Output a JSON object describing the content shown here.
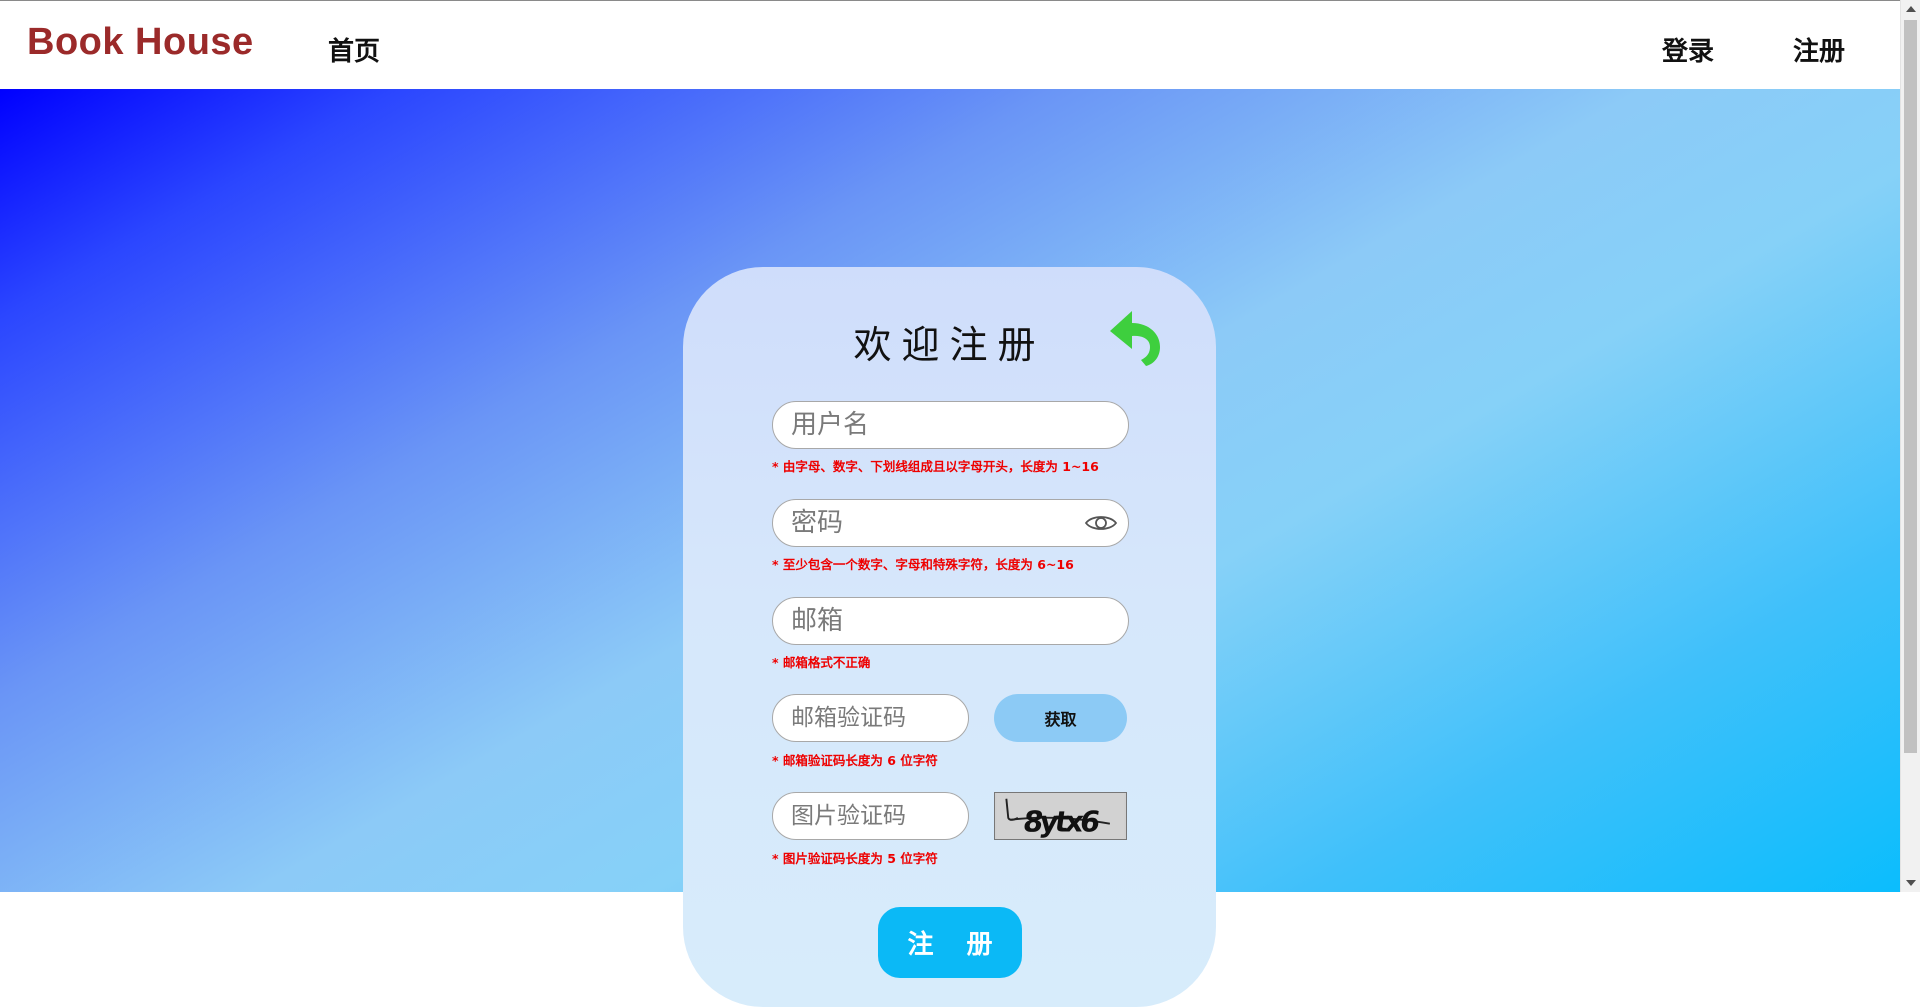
{
  "nav": {
    "brand": "Book House",
    "home": "首页",
    "login": "登录",
    "register": "注册"
  },
  "form": {
    "title": "欢迎注册",
    "back_icon": "undo-arrow-icon",
    "username": {
      "placeholder": "用户名",
      "hint": "* 由字母、数字、下划线组成且以字母开头，长度为 1~16"
    },
    "password": {
      "placeholder": "密码",
      "hint": "* 至少包含一个数字、字母和特殊字符，长度为 6~16",
      "toggle_icon": "eye-icon"
    },
    "email": {
      "placeholder": "邮箱",
      "hint": "* 邮箱格式不正确"
    },
    "email_code": {
      "placeholder": "邮箱验证码",
      "hint": "* 邮箱验证码长度为 6 位字符",
      "button": "获取"
    },
    "image_code": {
      "placeholder": "图片验证码",
      "hint": "* 图片验证码长度为 5 位字符",
      "captcha_text": "8ytx6"
    },
    "submit": "注 册"
  },
  "colors": {
    "brand": "#9b2a2a",
    "hint": "#ee0000",
    "submit_bg": "#0bb9f6",
    "get_button_bg": "#8ccaf5",
    "back_icon": "#3ecf3e"
  }
}
